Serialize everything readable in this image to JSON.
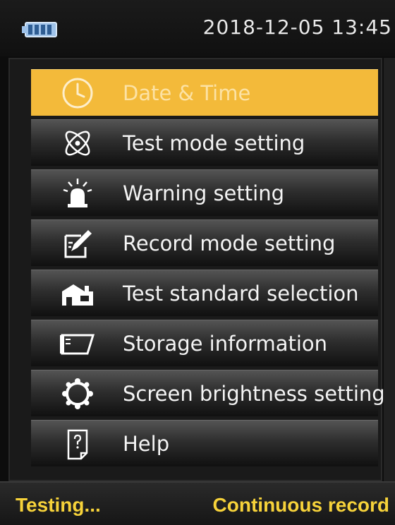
{
  "status": {
    "battery_icon": "battery-full-icon",
    "datetime": "2018-12-05 13:45"
  },
  "menu": {
    "items": [
      {
        "label": "Date & Time",
        "icon": "clock-icon",
        "selected": true
      },
      {
        "label": "Test mode setting",
        "icon": "atom-icon",
        "selected": false
      },
      {
        "label": "Warning setting",
        "icon": "alarm-light-icon",
        "selected": false
      },
      {
        "label": "Record mode setting",
        "icon": "edit-note-icon",
        "selected": false
      },
      {
        "label": "Test standard selection",
        "icon": "building-icon",
        "selected": false
      },
      {
        "label": "Storage information",
        "icon": "storage-card-icon",
        "selected": false
      },
      {
        "label": "Screen brightness setting",
        "icon": "brightness-icon",
        "selected": false
      },
      {
        "label": "Help",
        "icon": "help-document-icon",
        "selected": false
      }
    ]
  },
  "footer": {
    "left": "Testing...",
    "right": "Continuous record"
  },
  "colors": {
    "selected_bg": "#f3ba3a",
    "footer_text": "#f6d23a"
  }
}
